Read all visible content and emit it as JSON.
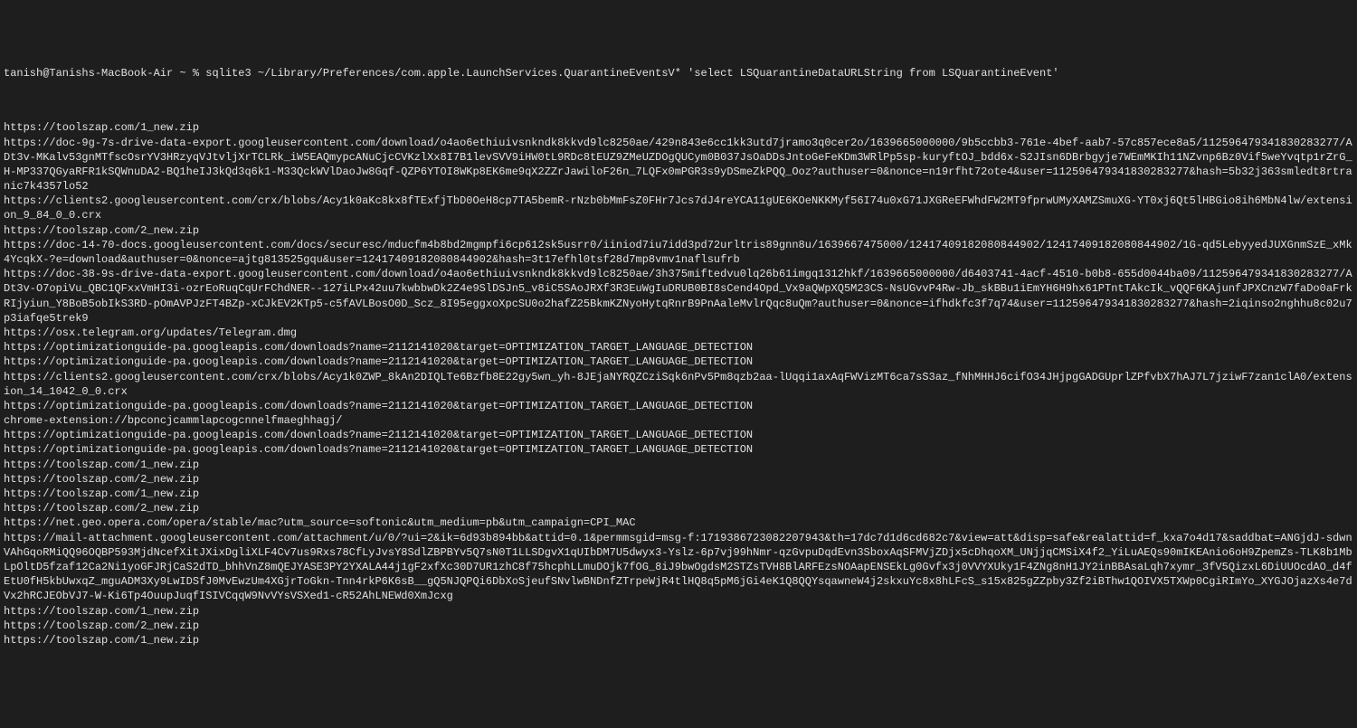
{
  "prompt": {
    "user_host": "tanish@Tanishs-MacBook-Air",
    "path": "~",
    "symbol": "%",
    "command": "sqlite3 ~/Library/Preferences/com.apple.LaunchServices.QuarantineEventsV* 'select LSQuarantineDataURLString from LSQuarantineEvent'"
  },
  "output": [
    "https://toolszap.com/1_new.zip",
    "https://doc-9g-7s-drive-data-export.googleusercontent.com/download/o4ao6ethiuivsnkndk8kkvd9lc8250ae/429n843e6cc1kk3utd7jramo3q0cer2o/1639665000000/9b5ccbb3-761e-4bef-aab7-57c857ece8a5/112596479341830283277/ADt3v-MKalv53gnMTfscOsrYV3HRzyqVJtvljXrTCLRk_iW5EAQmypcANuCjcCVKzlXx8I7B1levSVV9iHW0tL9RDc8tEUZ9ZMeUZDOgQUCym0B037JsOaDDsJntoGeFeKDm3WRlPp5sp-kuryftOJ_bdd6x-S2JIsn6DBrbgyje7WEmMKIh11NZvnp6Bz0Vif5weYvqtp1rZrG_H-MP337QGyaRFR1kSQWnuDA2-BQ1heIJ3kQd3q6k1-M33QckWVlDaoJw8Gqf-QZP6YTOI8WKp8EK6me9qX2ZZrJawiloF26n_7LQFx0mPGR3s9yDSmeZkPQQ_Ooz?authuser=0&nonce=n19rfht72ote4&user=112596479341830283277&hash=5b32j363smledt8rtranic7k4357lo52",
    "https://clients2.googleusercontent.com/crx/blobs/Acy1k0aKc8kx8fTExfjTbD0OeH8cp7TA5bemR-rNzb0bMmFsZ0FHr7Jcs7dJ4reYCA11gUE6KOeNKKMyf56I74u0xG71JXGReEFWhdFW2MT9fprwUMyXAMZSmuXG-YT0xj6Qt5lHBGio8ih6MbN4lw/extension_9_84_0_0.crx",
    "https://toolszap.com/2_new.zip",
    "https://doc-14-70-docs.googleusercontent.com/docs/securesc/mducfm4b8bd2mgmpfi6cp612sk5usrr0/iiniod7iu7idd3pd72urltris89gnn8u/1639667475000/12417409182080844902/12417409182080844902/1G-qd5LebyyedJUXGnmSzE_xMk4YcqkX-?e=download&authuser=0&nonce=ajtg813525gqu&user=12417409182080844902&hash=3t17efhl0tsf28d7mp8vmv1naflsufrb",
    "https://doc-38-9s-drive-data-export.googleusercontent.com/download/o4ao6ethiuivsnkndk8kkvd9lc8250ae/3h375miftedvu0lq26b61imgq1312hkf/1639665000000/d6403741-4acf-4510-b0b8-655d0044ba09/112596479341830283277/ADt3v-O7opiVu_QBC1QFxxVmHI3i-ozrEoRuqCqUrFChdNER--127iLPx42uu7kwbbwDk2Z4e9SlDSJn5_v8iC5SAoJRXf3R3EuWgIuDRUB0BI8sCend4Opd_Vx9aQWpXQ5M23CS-NsUGvvP4Rw-Jb_skBBu1iEmYH6H9hx61PTntTAkcIk_vQQF6KAjunfJPXCnzW7faDo0aFrkRIjyiun_Y8BoB5obIkS3RD-pOmAVPJzFT4BZp-xCJkEV2KTp5-c5fAVLBosO0D_Scz_8I95eggxoXpcSU0o2hafZ25BkmKZNyoHytqRnrB9PnAaleMvlrQqc8uQm?authuser=0&nonce=ifhdkfc3f7q74&user=112596479341830283277&hash=2iqinso2nghhu8c02u7p3iafqe5trek9",
    "https://osx.telegram.org/updates/Telegram.dmg",
    "https://optimizationguide-pa.googleapis.com/downloads?name=2112141020&target=OPTIMIZATION_TARGET_LANGUAGE_DETECTION",
    "https://optimizationguide-pa.googleapis.com/downloads?name=2112141020&target=OPTIMIZATION_TARGET_LANGUAGE_DETECTION",
    "https://clients2.googleusercontent.com/crx/blobs/Acy1k0ZWP_8kAn2DIQLTe6Bzfb8E22gy5wn_yh-8JEjaNYRQZCziSqk6nPv5Pm8qzb2aa-lUqqi1axAqFWVizMT6ca7sS3az_fNhMHHJ6cifO34JHjpgGADGUprlZPfvbX7hAJ7L7jziwF7zan1clA0/extension_14_1042_0_0.crx",
    "https://optimizationguide-pa.googleapis.com/downloads?name=2112141020&target=OPTIMIZATION_TARGET_LANGUAGE_DETECTION",
    "chrome-extension://bpconcjcammlapcogcnnelfmaeghhagj/",
    "https://optimizationguide-pa.googleapis.com/downloads?name=2112141020&target=OPTIMIZATION_TARGET_LANGUAGE_DETECTION",
    "https://optimizationguide-pa.googleapis.com/downloads?name=2112141020&target=OPTIMIZATION_TARGET_LANGUAGE_DETECTION",
    "https://toolszap.com/1_new.zip",
    "https://toolszap.com/2_new.zip",
    "https://toolszap.com/1_new.zip",
    "https://toolszap.com/2_new.zip",
    "https://net.geo.opera.com/opera/stable/mac?utm_source=softonic&utm_medium=pb&utm_campaign=CPI_MAC",
    "https://mail-attachment.googleusercontent.com/attachment/u/0/?ui=2&ik=6d93b894bb&attid=0.1&permmsgid=msg-f:1719386723082207943&th=17dc7d1d6cd682c7&view=att&disp=safe&realattid=f_kxa7o4d17&saddbat=ANGjdJ-sdwnVAhGqoRMiQQ96OQBP593MjdNcefXitJXixDgliXLF4Cv7us9Rxs78CfLyJvsY8SdlZBPBYv5Q7sN0T1LLSDgvX1qUIbDM7U5dwyx3-Yslz-6p7vj99hNmr-qzGvpuDqdEvn3SboxAqSFMVjZDjx5cDhqoXM_UNjjqCMSiX4f2_YiLuAEQs90mIKEAnio6oH9ZpemZs-TLK8b1MbLpOltD5fzaf12Ca2Ni1yoGFJRjCaS2dTD_bhhVnZ8mQEJYASE3PY2YXALA44j1gF2xfXc30D7UR1zhC8f75hcphLLmuDOjk7fOG_8iJ9bwOgdsM2STZsTVH8BlARFEzsNOAapENSEkLg0Gvfx3j0VVYXUky1F4ZNg8nH1JY2inBBAsaLqh7xymr_3fV5QizxL6DiUUOcdAO_d4fEtU0fH5kbUwxqZ_mguADM3Xy9LwIDSfJ0MvEwzUm4XGjrToGkn-Tnn4rkP6K6sB__gQ5NJQPQi6DbXoSjeufSNvlwBNDnfZTrpeWjR4tlHQ8q5pM6jGi4eK1Q8QQYsqawneW4j2skxuYc8x8hLFcS_s15x825gZZpby3Zf2iBThw1QOIVX5TXWp0CgiRImYo_XYGJOjazXs4e7dVx2hRCJEObVJ7-W-Ki6Tp4OuupJuqfISIVCqqW9NvVYsVSXed1-cR52AhLNEWd0XmJcxg",
    "https://toolszap.com/1_new.zip",
    "https://toolszap.com/2_new.zip",
    "https://toolszap.com/1_new.zip"
  ]
}
